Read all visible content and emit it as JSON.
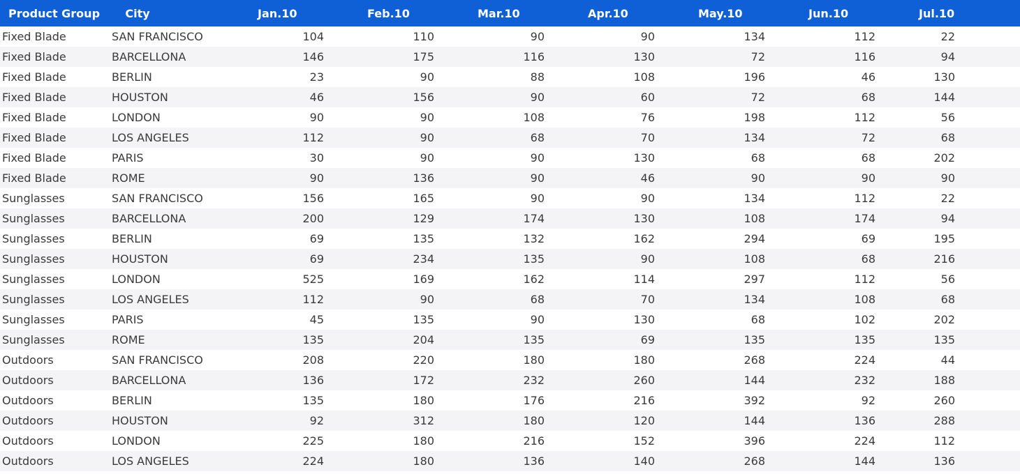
{
  "columns": [
    "Product Group",
    "City",
    "Jan.10",
    "Feb.10",
    "Mar.10",
    "Apr.10",
    "May.10",
    "Jun.10",
    "Jul.10"
  ],
  "rows": [
    [
      "Fixed Blade",
      "SAN FRANCISCO",
      "104",
      "110",
      "90",
      "90",
      "134",
      "112",
      "22"
    ],
    [
      "Fixed Blade",
      "BARCELLONA",
      "146",
      "175",
      "116",
      "130",
      "72",
      "116",
      "94"
    ],
    [
      "Fixed Blade",
      "BERLIN",
      "23",
      "90",
      "88",
      "108",
      "196",
      "46",
      "130"
    ],
    [
      "Fixed Blade",
      "HOUSTON",
      "46",
      "156",
      "90",
      "60",
      "72",
      "68",
      "144"
    ],
    [
      "Fixed Blade",
      "LONDON",
      "90",
      "90",
      "108",
      "76",
      "198",
      "112",
      "56"
    ],
    [
      "Fixed Blade",
      "LOS ANGELES",
      "112",
      "90",
      "68",
      "70",
      "134",
      "72",
      "68"
    ],
    [
      "Fixed Blade",
      "PARIS",
      "30",
      "90",
      "90",
      "130",
      "68",
      "68",
      "202"
    ],
    [
      "Fixed Blade",
      "ROME",
      "90",
      "136",
      "90",
      "46",
      "90",
      "90",
      "90"
    ],
    [
      "Sunglasses",
      "SAN FRANCISCO",
      "156",
      "165",
      "90",
      "90",
      "134",
      "112",
      "22"
    ],
    [
      "Sunglasses",
      "BARCELLONA",
      "200",
      "129",
      "174",
      "130",
      "108",
      "174",
      "94"
    ],
    [
      "Sunglasses",
      "BERLIN",
      "69",
      "135",
      "132",
      "162",
      "294",
      "69",
      "195"
    ],
    [
      "Sunglasses",
      "HOUSTON",
      "69",
      "234",
      "135",
      "90",
      "108",
      "68",
      "216"
    ],
    [
      "Sunglasses",
      "LONDON",
      "525",
      "169",
      "162",
      "114",
      "297",
      "112",
      "56"
    ],
    [
      "Sunglasses",
      "LOS ANGELES",
      "112",
      "90",
      "68",
      "70",
      "134",
      "108",
      "68"
    ],
    [
      "Sunglasses",
      "PARIS",
      "45",
      "135",
      "90",
      "130",
      "68",
      "102",
      "202"
    ],
    [
      "Sunglasses",
      "ROME",
      "135",
      "204",
      "135",
      "69",
      "135",
      "135",
      "135"
    ],
    [
      "Outdoors",
      "SAN FRANCISCO",
      "208",
      "220",
      "180",
      "180",
      "268",
      "224",
      "44"
    ],
    [
      "Outdoors",
      "BARCELLONA",
      "136",
      "172",
      "232",
      "260",
      "144",
      "232",
      "188"
    ],
    [
      "Outdoors",
      "BERLIN",
      "135",
      "180",
      "176",
      "216",
      "392",
      "92",
      "260"
    ],
    [
      "Outdoors",
      "HOUSTON",
      "92",
      "312",
      "180",
      "120",
      "144",
      "136",
      "288"
    ],
    [
      "Outdoors",
      "LONDON",
      "225",
      "180",
      "216",
      "152",
      "396",
      "224",
      "112"
    ],
    [
      "Outdoors",
      "LOS ANGELES",
      "224",
      "180",
      "136",
      "140",
      "268",
      "144",
      "136"
    ]
  ],
  "colors": {
    "header_bg": "#0f5fd6",
    "header_text": "#ffffff",
    "row_alt_bg": "#f4f4f6",
    "text": "#3a3a3a"
  }
}
